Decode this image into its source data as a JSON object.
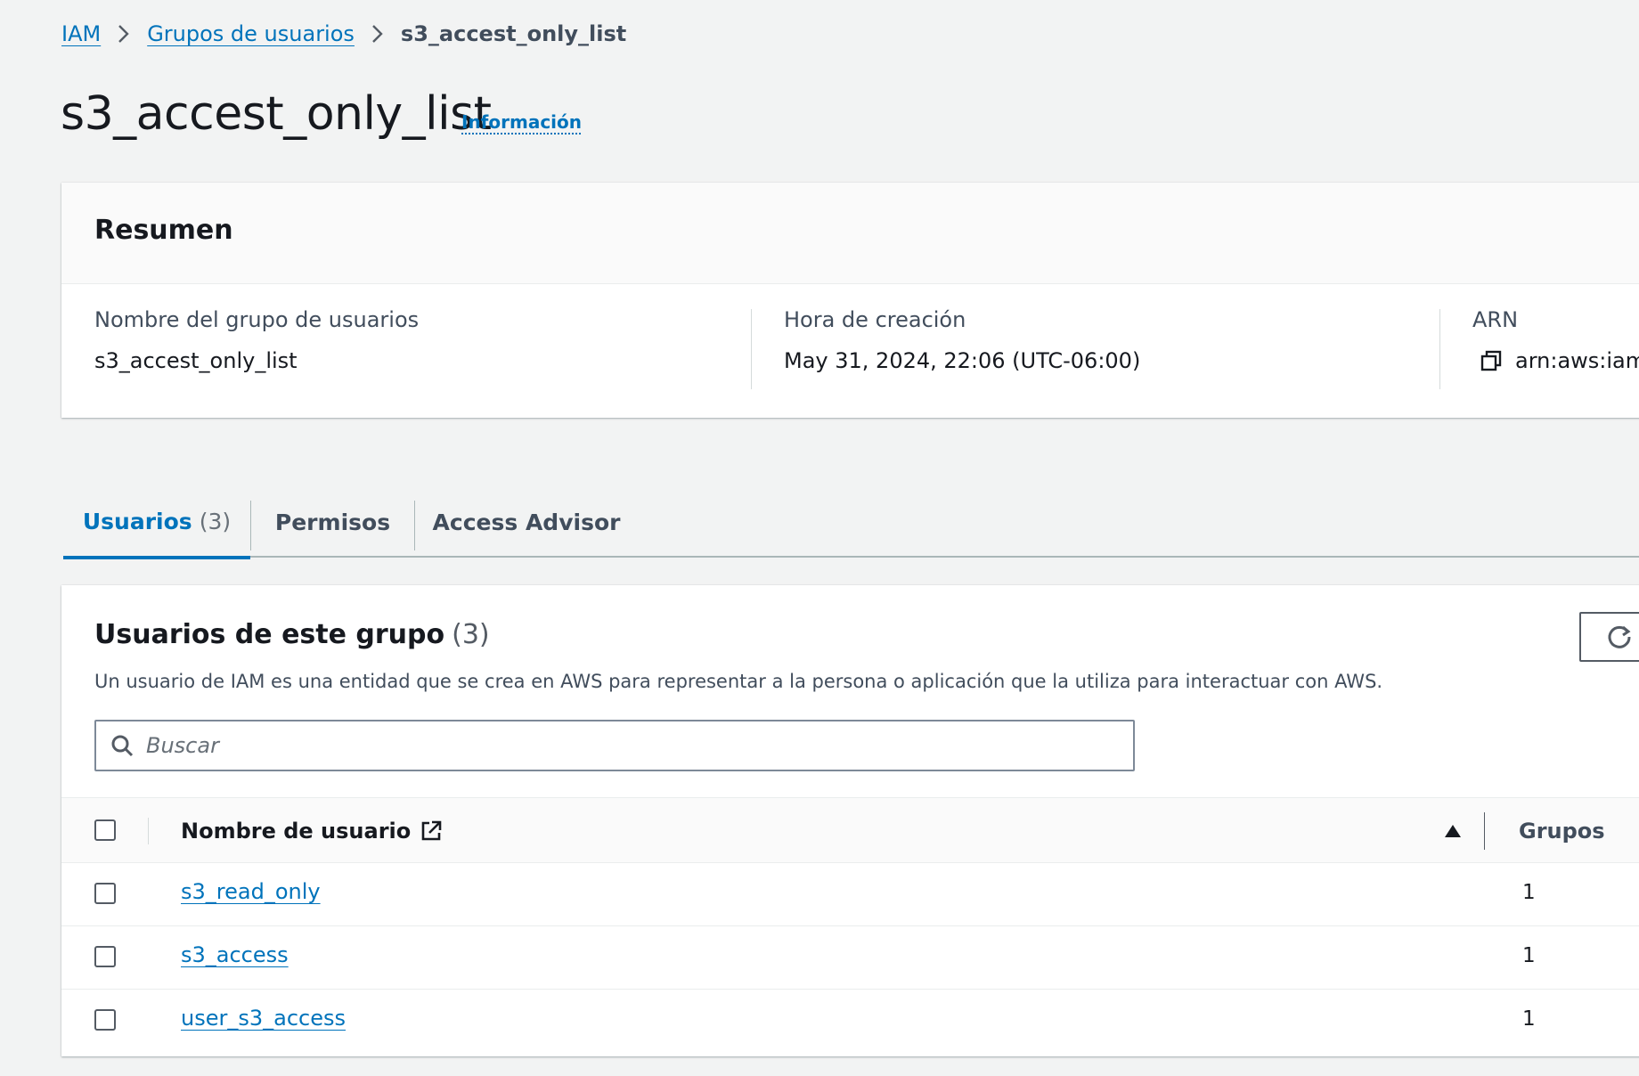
{
  "breadcrumb": {
    "items": [
      "IAM",
      "Grupos de usuarios"
    ],
    "current": "s3_accest_only_list"
  },
  "page": {
    "title": "s3_accest_only_list",
    "info_link": "Información"
  },
  "summary": {
    "title": "Resumen",
    "fields": [
      {
        "label": "Nombre del grupo de usuarios",
        "value": "s3_accest_only_list"
      },
      {
        "label": "Hora de creación",
        "value": "May 31, 2024, 22:06 (UTC-06:00)"
      },
      {
        "label": "ARN",
        "value": "arn:aws:iam:"
      }
    ]
  },
  "tabs": [
    {
      "label": "Usuarios",
      "count": "(3)"
    },
    {
      "label": "Permisos"
    },
    {
      "label": "Access Advisor"
    }
  ],
  "users_panel": {
    "title": "Usuarios de este grupo",
    "count": "(3)",
    "description": "Un usuario de IAM es una entidad que se crea en AWS para representar a la persona o aplicación que la utiliza para interactuar con AWS.",
    "search_placeholder": "Buscar",
    "columns": {
      "name": "Nombre de usuario",
      "groups": "Grupos"
    },
    "rows": [
      {
        "name": "s3_read_only",
        "groups": "1"
      },
      {
        "name": "s3_access",
        "groups": "1"
      },
      {
        "name": "user_s3_access",
        "groups": "1"
      }
    ]
  },
  "icons": {
    "breadcrumb_separator": "chevron-right-icon",
    "copy": "copy-icon",
    "external_link": "external-link-icon",
    "search": "search-icon",
    "refresh": "refresh-icon",
    "sort": "sort-ascending-icon"
  },
  "colors": {
    "link": "#0073bb",
    "background": "#f2f3f3",
    "text": "#16191f"
  }
}
